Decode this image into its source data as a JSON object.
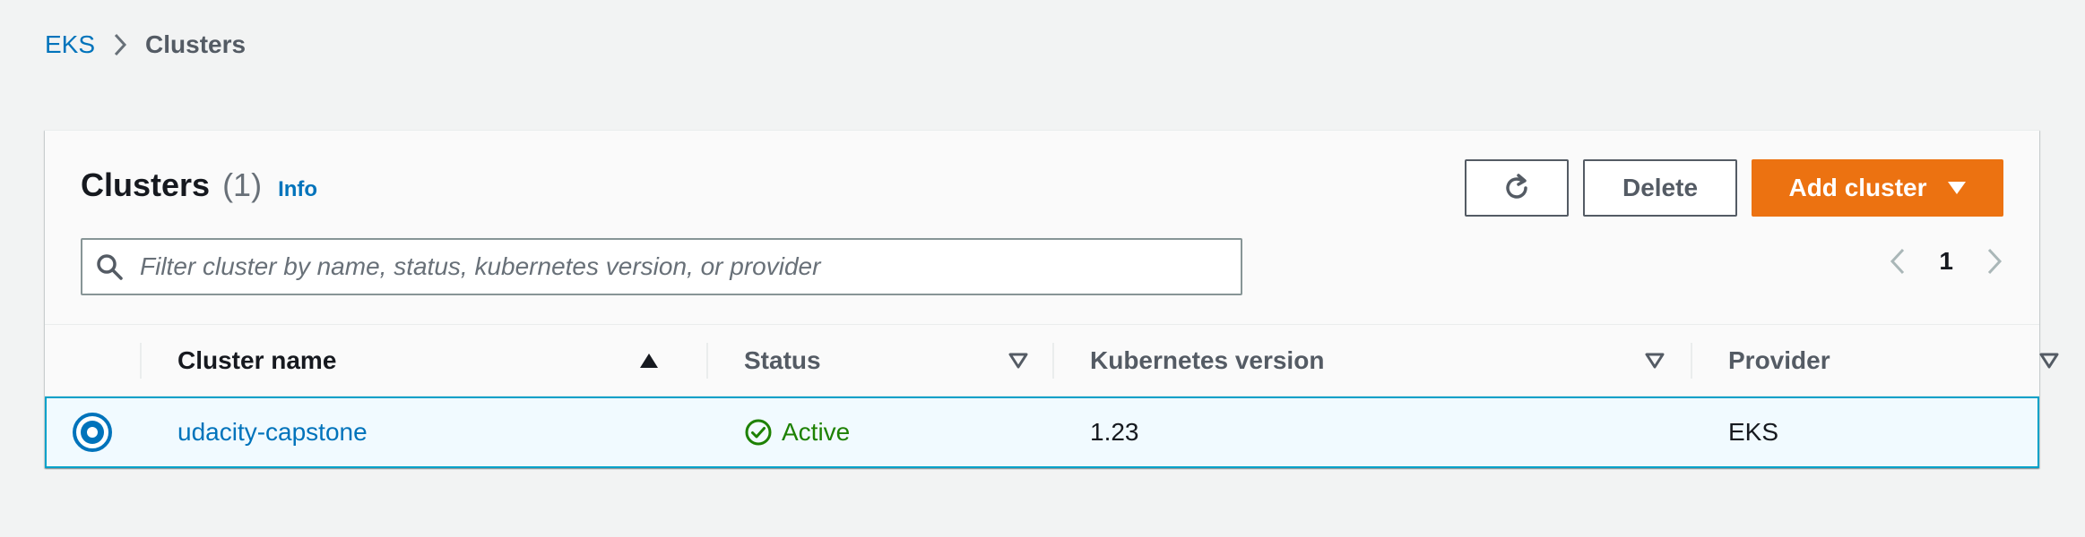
{
  "breadcrumb": {
    "root": "EKS",
    "current": "Clusters"
  },
  "panel": {
    "title": "Clusters",
    "count": "(1)",
    "info_label": "Info"
  },
  "actions": {
    "refresh_icon": "refresh-icon",
    "delete_label": "Delete",
    "add_label": "Add cluster"
  },
  "search": {
    "placeholder": "Filter cluster by name, status, kubernetes version, or provider",
    "value": ""
  },
  "pagination": {
    "current_page": "1"
  },
  "table": {
    "columns": [
      {
        "label": "Cluster name",
        "sort": "ascending"
      },
      {
        "label": "Status",
        "sort": "none"
      },
      {
        "label": "Kubernetes version",
        "sort": "none"
      },
      {
        "label": "Provider",
        "sort": "none"
      }
    ],
    "rows": [
      {
        "selected": true,
        "name": "udacity-capstone",
        "status": "Active",
        "kubernetes_version": "1.23",
        "provider": "EKS"
      }
    ]
  },
  "colors": {
    "accent": "#ec7211",
    "link": "#0073bb",
    "success": "#1d8102",
    "selected_row_bg": "#f1faff",
    "selected_row_border": "#00a1c9"
  }
}
